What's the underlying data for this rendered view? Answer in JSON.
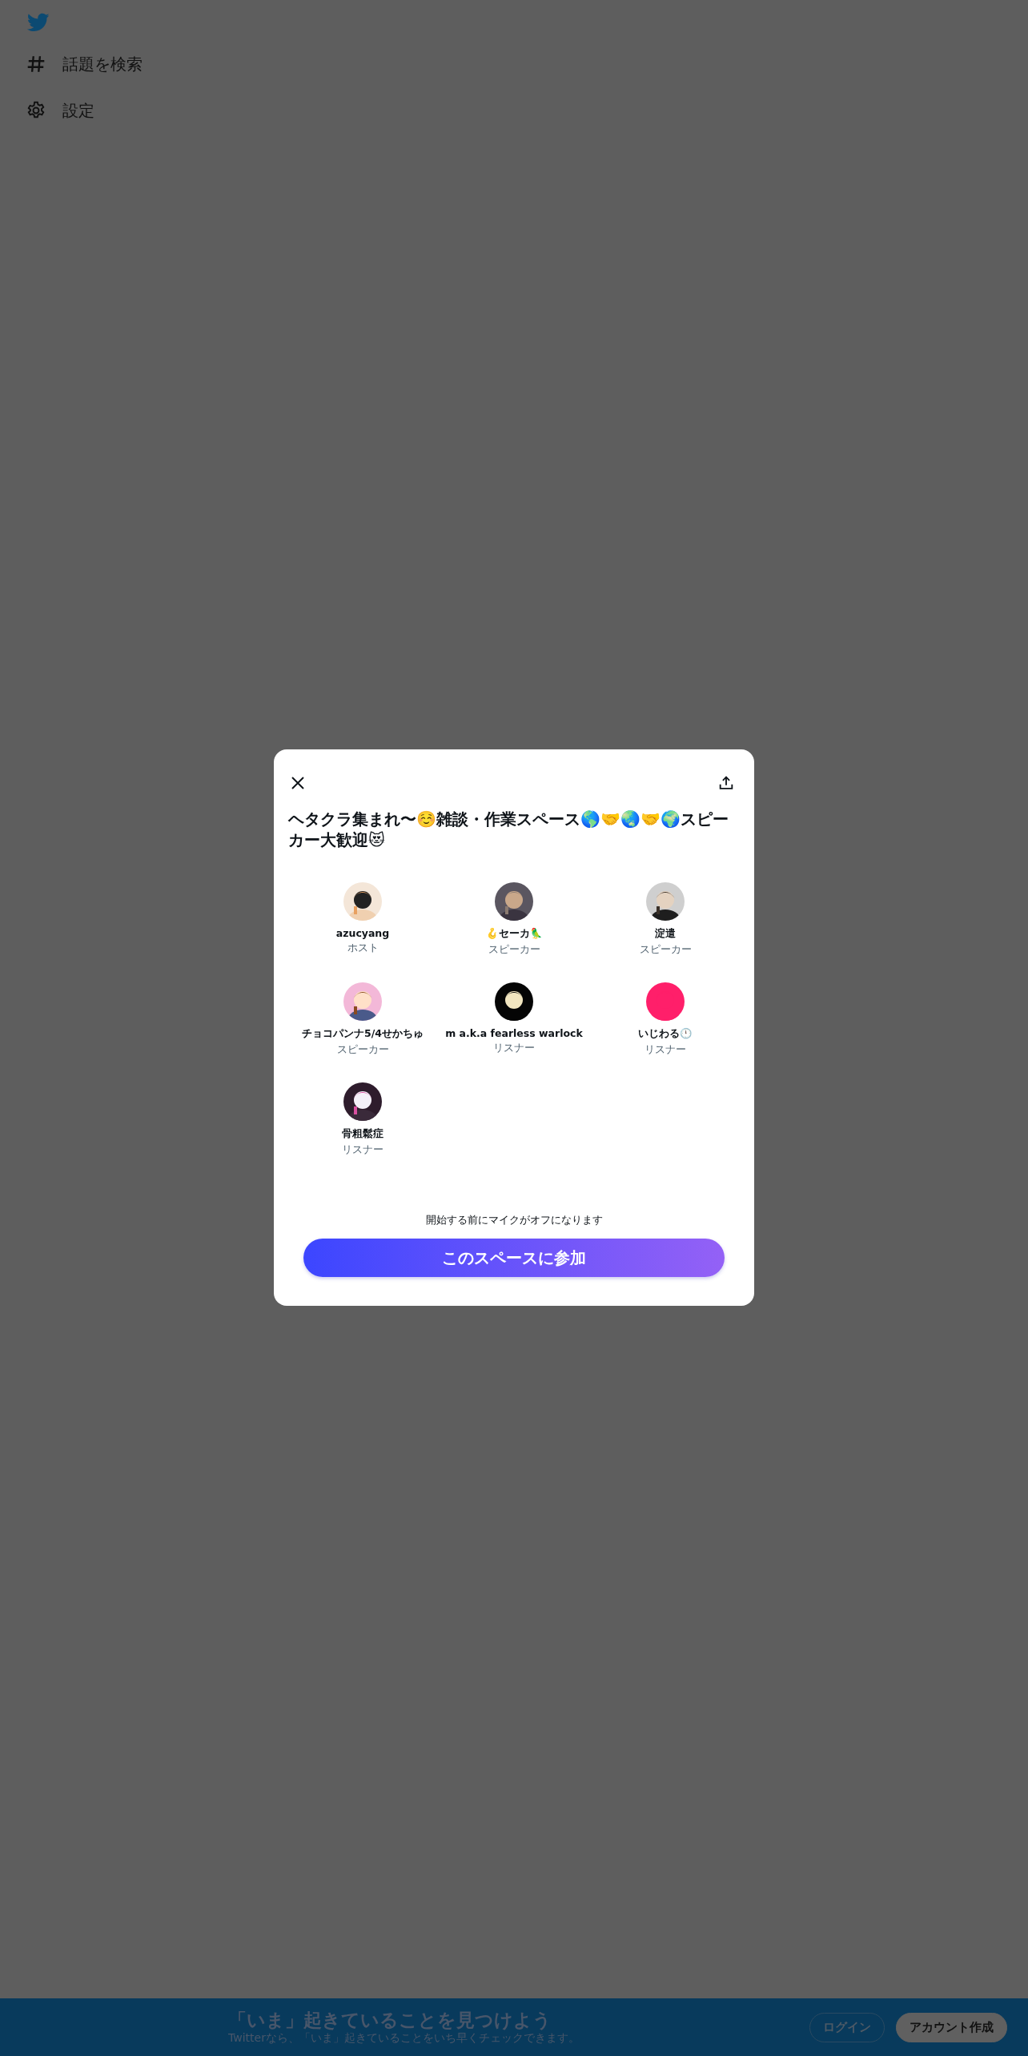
{
  "nav": {
    "items": [
      {
        "kind": "hashtag",
        "label": "話題を検索"
      },
      {
        "kind": "settings",
        "label": "設定"
      }
    ]
  },
  "space": {
    "title": "ヘタクラ集まれ〜☺️雑談・作業スペース🌎🤝🌏🤝🌍スピーカー大歓迎😻",
    "participants": [
      {
        "name": "azucyang",
        "role": "ホスト"
      },
      {
        "name": "🪝セーカ🦜",
        "role": "スピーカー"
      },
      {
        "name": "淀遣",
        "role": "スピーカー"
      },
      {
        "name": "チョコパンナ5/4せかちゅ",
        "role": "スピーカー"
      },
      {
        "name": "m a.k.a fearless warlock",
        "role": "リスナー"
      },
      {
        "name": "いじわる🕛",
        "role": "リスナー"
      },
      {
        "name": "骨粗鬆症",
        "role": "リスナー"
      }
    ],
    "notice": "開始する前にマイクがオフになります",
    "join_button": "このスペースに参加"
  },
  "bottom_bar": {
    "title": "「いま」起きていることを見つけよう",
    "subtitle": "Twitterなら、「いま」起きていることをいち早くチェックできます。",
    "buttons": [
      {
        "kind": "outline",
        "label": "ログイン"
      },
      {
        "kind": "filled",
        "label": "アカウント作成"
      }
    ]
  }
}
